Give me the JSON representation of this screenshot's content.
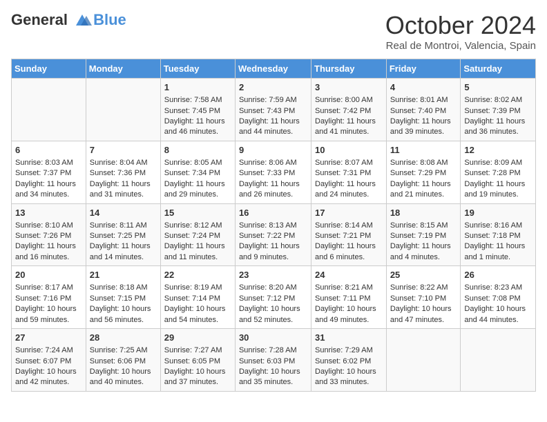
{
  "header": {
    "logo_line1": "General",
    "logo_line2": "Blue",
    "month_title": "October 2024",
    "location": "Real de Montroi, Valencia, Spain"
  },
  "days_of_week": [
    "Sunday",
    "Monday",
    "Tuesday",
    "Wednesday",
    "Thursday",
    "Friday",
    "Saturday"
  ],
  "weeks": [
    [
      {
        "day": "",
        "sunrise": "",
        "sunset": "",
        "daylight": ""
      },
      {
        "day": "",
        "sunrise": "",
        "sunset": "",
        "daylight": ""
      },
      {
        "day": "1",
        "sunrise": "Sunrise: 7:58 AM",
        "sunset": "Sunset: 7:45 PM",
        "daylight": "Daylight: 11 hours and 46 minutes."
      },
      {
        "day": "2",
        "sunrise": "Sunrise: 7:59 AM",
        "sunset": "Sunset: 7:43 PM",
        "daylight": "Daylight: 11 hours and 44 minutes."
      },
      {
        "day": "3",
        "sunrise": "Sunrise: 8:00 AM",
        "sunset": "Sunset: 7:42 PM",
        "daylight": "Daylight: 11 hours and 41 minutes."
      },
      {
        "day": "4",
        "sunrise": "Sunrise: 8:01 AM",
        "sunset": "Sunset: 7:40 PM",
        "daylight": "Daylight: 11 hours and 39 minutes."
      },
      {
        "day": "5",
        "sunrise": "Sunrise: 8:02 AM",
        "sunset": "Sunset: 7:39 PM",
        "daylight": "Daylight: 11 hours and 36 minutes."
      }
    ],
    [
      {
        "day": "6",
        "sunrise": "Sunrise: 8:03 AM",
        "sunset": "Sunset: 7:37 PM",
        "daylight": "Daylight: 11 hours and 34 minutes."
      },
      {
        "day": "7",
        "sunrise": "Sunrise: 8:04 AM",
        "sunset": "Sunset: 7:36 PM",
        "daylight": "Daylight: 11 hours and 31 minutes."
      },
      {
        "day": "8",
        "sunrise": "Sunrise: 8:05 AM",
        "sunset": "Sunset: 7:34 PM",
        "daylight": "Daylight: 11 hours and 29 minutes."
      },
      {
        "day": "9",
        "sunrise": "Sunrise: 8:06 AM",
        "sunset": "Sunset: 7:33 PM",
        "daylight": "Daylight: 11 hours and 26 minutes."
      },
      {
        "day": "10",
        "sunrise": "Sunrise: 8:07 AM",
        "sunset": "Sunset: 7:31 PM",
        "daylight": "Daylight: 11 hours and 24 minutes."
      },
      {
        "day": "11",
        "sunrise": "Sunrise: 8:08 AM",
        "sunset": "Sunset: 7:29 PM",
        "daylight": "Daylight: 11 hours and 21 minutes."
      },
      {
        "day": "12",
        "sunrise": "Sunrise: 8:09 AM",
        "sunset": "Sunset: 7:28 PM",
        "daylight": "Daylight: 11 hours and 19 minutes."
      }
    ],
    [
      {
        "day": "13",
        "sunrise": "Sunrise: 8:10 AM",
        "sunset": "Sunset: 7:26 PM",
        "daylight": "Daylight: 11 hours and 16 minutes."
      },
      {
        "day": "14",
        "sunrise": "Sunrise: 8:11 AM",
        "sunset": "Sunset: 7:25 PM",
        "daylight": "Daylight: 11 hours and 14 minutes."
      },
      {
        "day": "15",
        "sunrise": "Sunrise: 8:12 AM",
        "sunset": "Sunset: 7:24 PM",
        "daylight": "Daylight: 11 hours and 11 minutes."
      },
      {
        "day": "16",
        "sunrise": "Sunrise: 8:13 AM",
        "sunset": "Sunset: 7:22 PM",
        "daylight": "Daylight: 11 hours and 9 minutes."
      },
      {
        "day": "17",
        "sunrise": "Sunrise: 8:14 AM",
        "sunset": "Sunset: 7:21 PM",
        "daylight": "Daylight: 11 hours and 6 minutes."
      },
      {
        "day": "18",
        "sunrise": "Sunrise: 8:15 AM",
        "sunset": "Sunset: 7:19 PM",
        "daylight": "Daylight: 11 hours and 4 minutes."
      },
      {
        "day": "19",
        "sunrise": "Sunrise: 8:16 AM",
        "sunset": "Sunset: 7:18 PM",
        "daylight": "Daylight: 11 hours and 1 minute."
      }
    ],
    [
      {
        "day": "20",
        "sunrise": "Sunrise: 8:17 AM",
        "sunset": "Sunset: 7:16 PM",
        "daylight": "Daylight: 10 hours and 59 minutes."
      },
      {
        "day": "21",
        "sunrise": "Sunrise: 8:18 AM",
        "sunset": "Sunset: 7:15 PM",
        "daylight": "Daylight: 10 hours and 56 minutes."
      },
      {
        "day": "22",
        "sunrise": "Sunrise: 8:19 AM",
        "sunset": "Sunset: 7:14 PM",
        "daylight": "Daylight: 10 hours and 54 minutes."
      },
      {
        "day": "23",
        "sunrise": "Sunrise: 8:20 AM",
        "sunset": "Sunset: 7:12 PM",
        "daylight": "Daylight: 10 hours and 52 minutes."
      },
      {
        "day": "24",
        "sunrise": "Sunrise: 8:21 AM",
        "sunset": "Sunset: 7:11 PM",
        "daylight": "Daylight: 10 hours and 49 minutes."
      },
      {
        "day": "25",
        "sunrise": "Sunrise: 8:22 AM",
        "sunset": "Sunset: 7:10 PM",
        "daylight": "Daylight: 10 hours and 47 minutes."
      },
      {
        "day": "26",
        "sunrise": "Sunrise: 8:23 AM",
        "sunset": "Sunset: 7:08 PM",
        "daylight": "Daylight: 10 hours and 44 minutes."
      }
    ],
    [
      {
        "day": "27",
        "sunrise": "Sunrise: 7:24 AM",
        "sunset": "Sunset: 6:07 PM",
        "daylight": "Daylight: 10 hours and 42 minutes."
      },
      {
        "day": "28",
        "sunrise": "Sunrise: 7:25 AM",
        "sunset": "Sunset: 6:06 PM",
        "daylight": "Daylight: 10 hours and 40 minutes."
      },
      {
        "day": "29",
        "sunrise": "Sunrise: 7:27 AM",
        "sunset": "Sunset: 6:05 PM",
        "daylight": "Daylight: 10 hours and 37 minutes."
      },
      {
        "day": "30",
        "sunrise": "Sunrise: 7:28 AM",
        "sunset": "Sunset: 6:03 PM",
        "daylight": "Daylight: 10 hours and 35 minutes."
      },
      {
        "day": "31",
        "sunrise": "Sunrise: 7:29 AM",
        "sunset": "Sunset: 6:02 PM",
        "daylight": "Daylight: 10 hours and 33 minutes."
      },
      {
        "day": "",
        "sunrise": "",
        "sunset": "",
        "daylight": ""
      },
      {
        "day": "",
        "sunrise": "",
        "sunset": "",
        "daylight": ""
      }
    ]
  ]
}
